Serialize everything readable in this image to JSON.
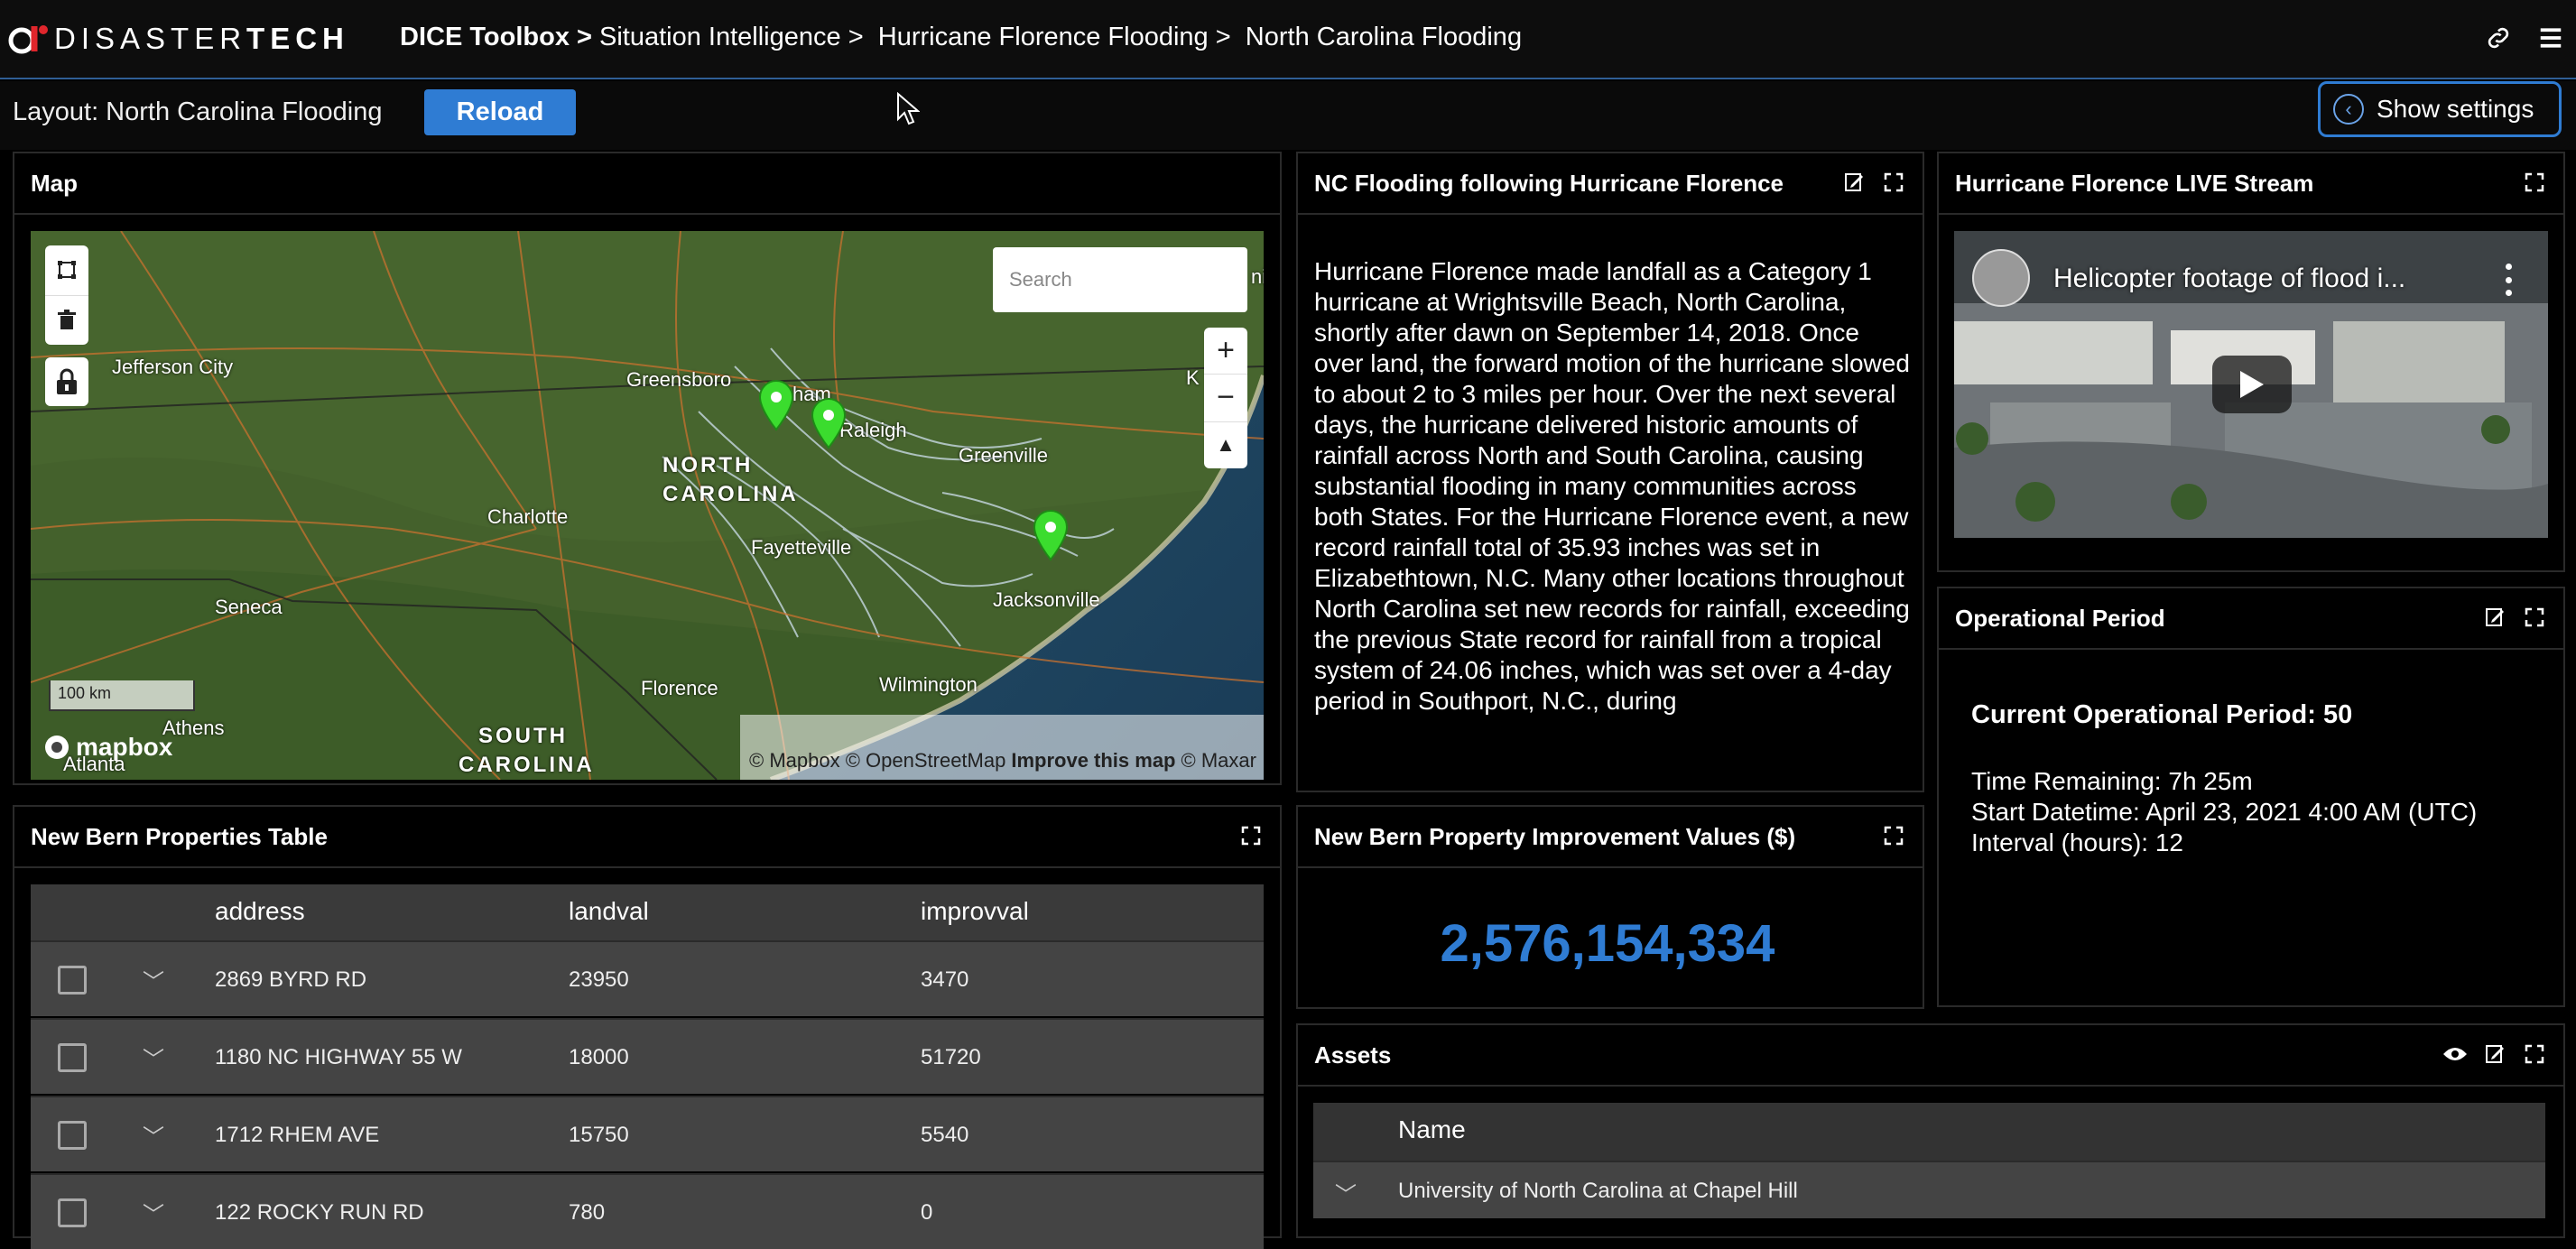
{
  "topbar": {
    "logo_bold": "DISASTER",
    "logo_rest": "TECH",
    "breadcrumb": [
      "DICE Toolbox >",
      "Situation Intelligence >",
      "Hurricane Florence Flooding >",
      "North Carolina Flooding"
    ]
  },
  "layoutbar": {
    "label": "Layout: North Carolina Flooding",
    "reload": "Reload",
    "show_settings": "Show settings"
  },
  "map_panel": {
    "title": "Map",
    "search_placeholder": "Search",
    "scale": "100 km",
    "attribution": [
      "© Mapbox © OpenStreetMap",
      "Improve this map",
      "© Maxar"
    ],
    "brand": "mapbox",
    "labels": {
      "jefferson_city": "Jefferson City",
      "greensboro": "Greensboro",
      "raleigh": "Raleigh",
      "durham": "ham",
      "north": "NORTH",
      "carolina": "CAROLINA",
      "greenville": "Greenville",
      "charlotte": "Charlotte",
      "fayetteville": "Fayetteville",
      "seneca": "Seneca",
      "jacksonville": "Jacksonville",
      "wilmington": "Wilmington",
      "florence": "Florence",
      "athens": "Athens",
      "atlanta": "Atlanta",
      "south": "SOUTH",
      "carolina_s": "CAROLINA",
      "kitty": "K",
      "nia": "nia"
    }
  },
  "narrative_panel": {
    "title": "NC Flooding following Hurricane Florence",
    "text": "Hurricane Florence made landfall as a Category 1 hurricane at Wrightsville Beach, North Carolina, shortly after dawn on September 14, 2018. Once over land, the forward motion of the hurricane slowed to about 2 to 3 miles per hour. Over the next several days, the hurricane delivered historic amounts of rainfall across North and South Carolina, causing substantial flooding in many communities across both States. For the Hurricane Florence event, a new record rainfall total of 35.93 inches was set in Elizabethtown, N.C. Many other locations throughout North Carolina set new records for rainfall, exceeding the previous State record for rainfall from a tropical system of 24.06 inches, which was set over a 4-day period in Southport, N.C., during"
  },
  "stream_panel": {
    "title": "Hurricane Florence LIVE Stream",
    "video_title": "Helicopter footage of flood i..."
  },
  "op_panel": {
    "title": "Operational Period",
    "current": "Current Operational Period: 50",
    "remaining": "Time Remaining: 7h 25m",
    "start": "Start Datetime: April 23, 2021 4:00 AM (UTC)",
    "interval": "Interval (hours): 12"
  },
  "table_panel": {
    "title": "New Bern Properties Table",
    "columns": [
      "address",
      "landval",
      "improvval"
    ],
    "rows": [
      [
        "2869 BYRD RD",
        "23950",
        "3470"
      ],
      [
        "1180 NC HIGHWAY 55 W",
        "18000",
        "51720"
      ],
      [
        "1712 RHEM AVE",
        "15750",
        "5540"
      ],
      [
        "122 ROCKY RUN RD",
        "780",
        "0"
      ]
    ]
  },
  "value_panel": {
    "title": "New Bern Property Improvement Values ($)",
    "value": "2,576,154,334",
    "color": "#2f7cd3"
  },
  "assets_panel": {
    "title": "Assets",
    "column": "Name",
    "rows": [
      "University of North Carolina at Chapel Hill"
    ]
  },
  "icons": [
    "link-icon",
    "menu-icon",
    "chevron-left-icon",
    "edit-icon",
    "expand-icon",
    "eye-icon",
    "polygon-draw-icon",
    "trash-icon",
    "lock-icon",
    "map-pin-icon",
    "play-icon",
    "more-vert-icon"
  ]
}
